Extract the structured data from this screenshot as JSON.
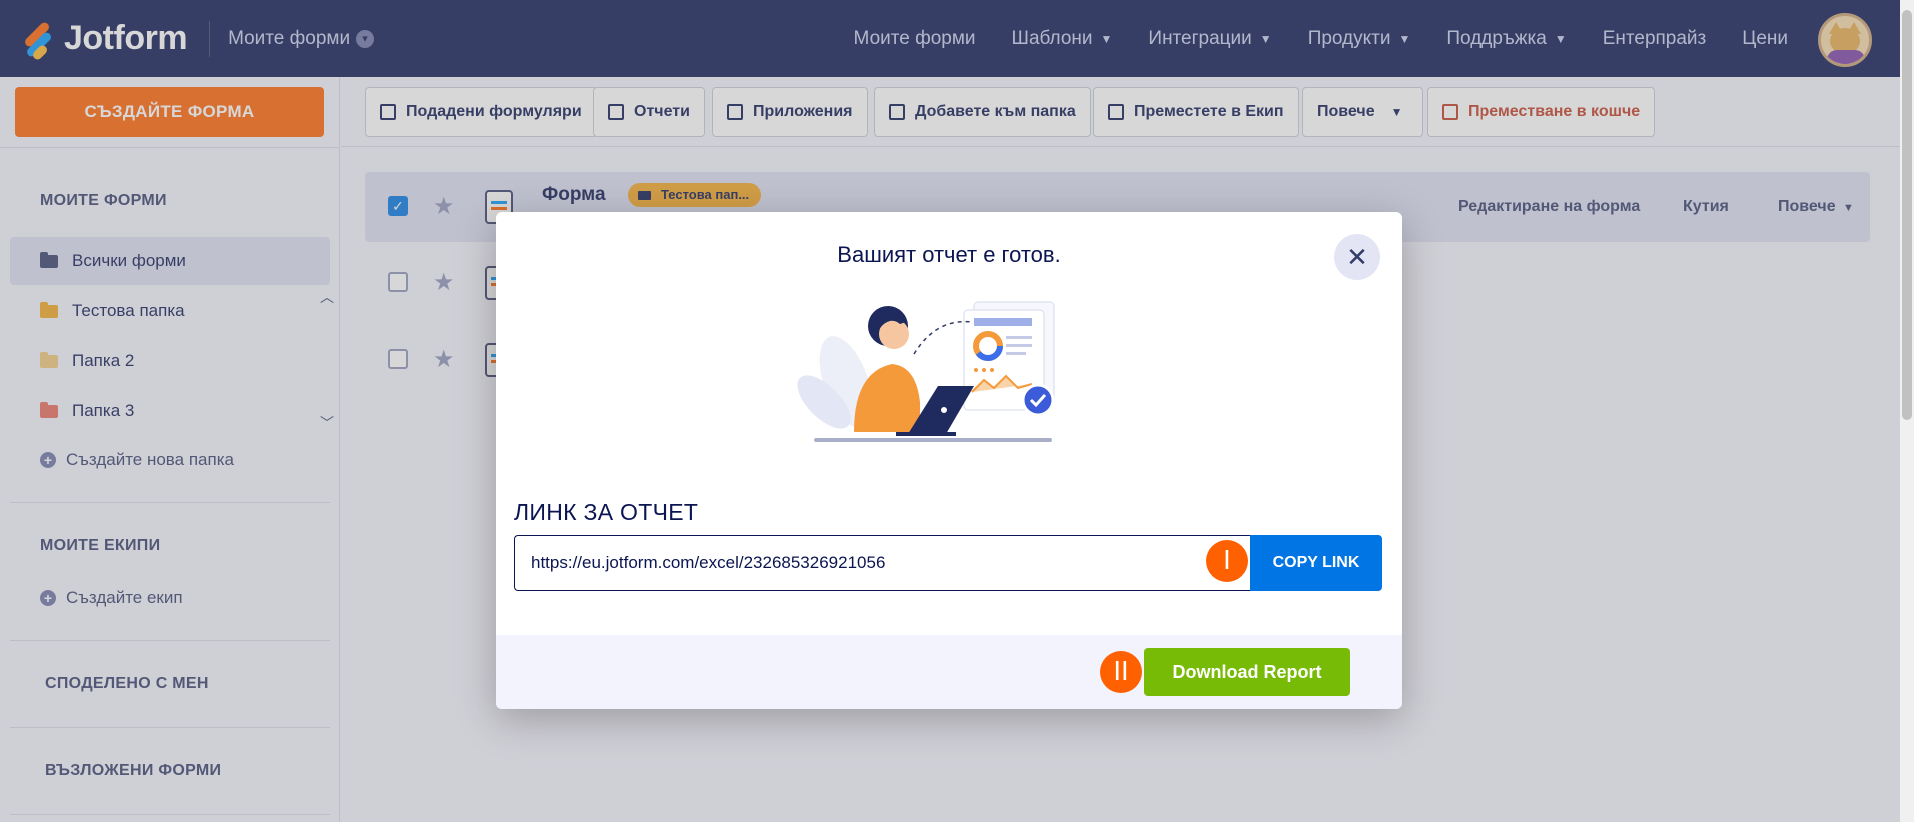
{
  "header": {
    "logo_text": "Jotform",
    "my_forms_dropdown": "Моите форми",
    "nav": [
      {
        "label": "Моите форми",
        "has_caret": false
      },
      {
        "label": "Шаблони",
        "has_caret": true
      },
      {
        "label": "Интеграции",
        "has_caret": true
      },
      {
        "label": "Продукти",
        "has_caret": true
      },
      {
        "label": "Поддръжка",
        "has_caret": true
      },
      {
        "label": "Ентерпрайз",
        "has_caret": false
      },
      {
        "label": "Цени",
        "has_caret": false
      }
    ]
  },
  "sidebar": {
    "create_button": "СЪЗДАЙТЕ ФОРМА",
    "my_forms_heading": "МОИТЕ ФОРМИ",
    "folders": [
      {
        "label": "Всички форми",
        "color": "#343c6a",
        "active": true
      },
      {
        "label": "Тестова папка",
        "color": "#f5a623",
        "active": false
      },
      {
        "label": "Папка 2",
        "color": "#f0c87a",
        "active": false
      },
      {
        "label": "Папка 3",
        "color": "#e86a5a",
        "active": false
      }
    ],
    "new_folder": "Създайте нова папка",
    "my_teams_heading": "МОИТЕ ЕКИПИ",
    "new_team": "Създайте екип",
    "shared_heading": "СПОДЕЛЕНО С МЕН",
    "assigned_heading": "ВЪЗЛОЖЕНИ ФОРМИ"
  },
  "toolbar": {
    "buttons": [
      "Подадени формуляри",
      "Отчети",
      "Приложения",
      "Добавете към папка",
      "Преместете в Екип",
      "Повече",
      "Преместване в кошче"
    ]
  },
  "list": {
    "form_title": "Форма",
    "folder_badge": "Тестова пап...",
    "actions": [
      "Редактиране на форма",
      "Кутия",
      "Повече"
    ]
  },
  "modal": {
    "title": "Вашият отчет е готов.",
    "section_label": "ЛИНК ЗА ОТЧЕТ",
    "report_url": "https://eu.jotform.com/excel/232685326921056",
    "copy_button": "COPY LINK",
    "download_button": "Download Report",
    "markers": [
      "I",
      "II"
    ]
  },
  "colors": {
    "nav_bg": "#0a1551",
    "create_button": "#ff6100",
    "copy_button": "#0075e3",
    "download_button": "#78bb07",
    "marker": "#ff6100"
  }
}
